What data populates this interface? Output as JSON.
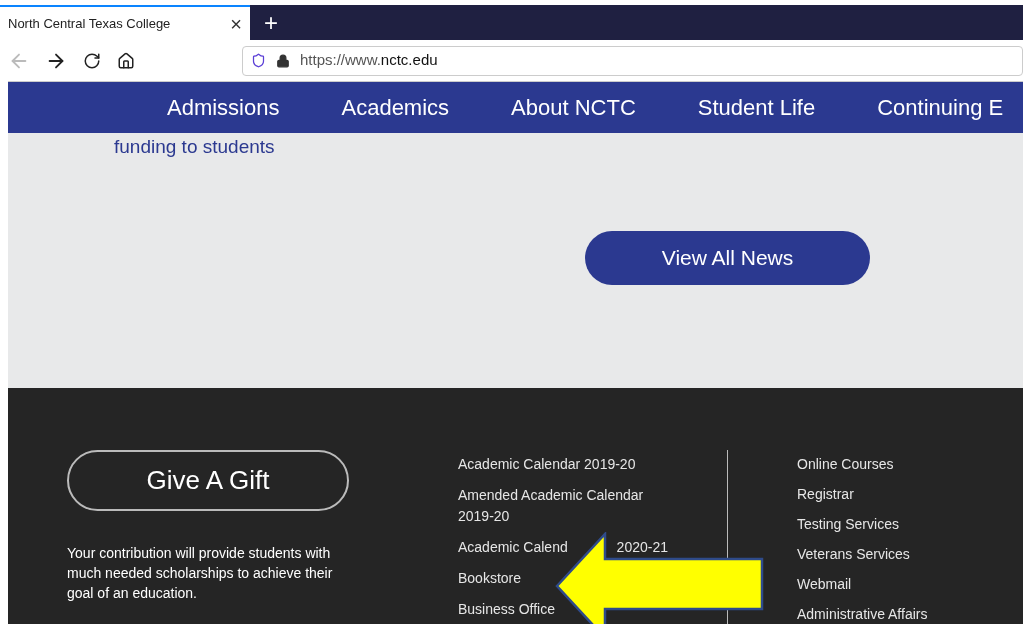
{
  "browser": {
    "tab_title": "North Central Texas College",
    "tab_close": "×",
    "new_tab": "+",
    "url_prefix": "https://www.",
    "url_domain": "nctc.edu"
  },
  "nav": [
    "Admissions",
    "Academics",
    "About NCTC",
    "Student Life",
    "Continuing E"
  ],
  "news": {
    "text": "funding to students",
    "button": "View All News"
  },
  "footer": {
    "gift_button": "Give A Gift",
    "gift_text": "Your contribution will provide students with much needed scholarships to achieve their goal of an education.",
    "links_1": [
      {
        "parts": [
          "Academic Calendar 2019-20"
        ]
      },
      {
        "parts": [
          "Amended Academic Calendar 2019-20"
        ]
      },
      {
        "parts": [
          "Academic Calend",
          "2020-21"
        ]
      },
      {
        "parts": [
          "Bookstore"
        ]
      },
      {
        "parts": [
          "Business Office"
        ]
      }
    ],
    "links_2": [
      "Online Courses",
      "Registrar",
      "Testing Services",
      "Veterans Services",
      "Webmail",
      "Administrative Affairs"
    ]
  }
}
